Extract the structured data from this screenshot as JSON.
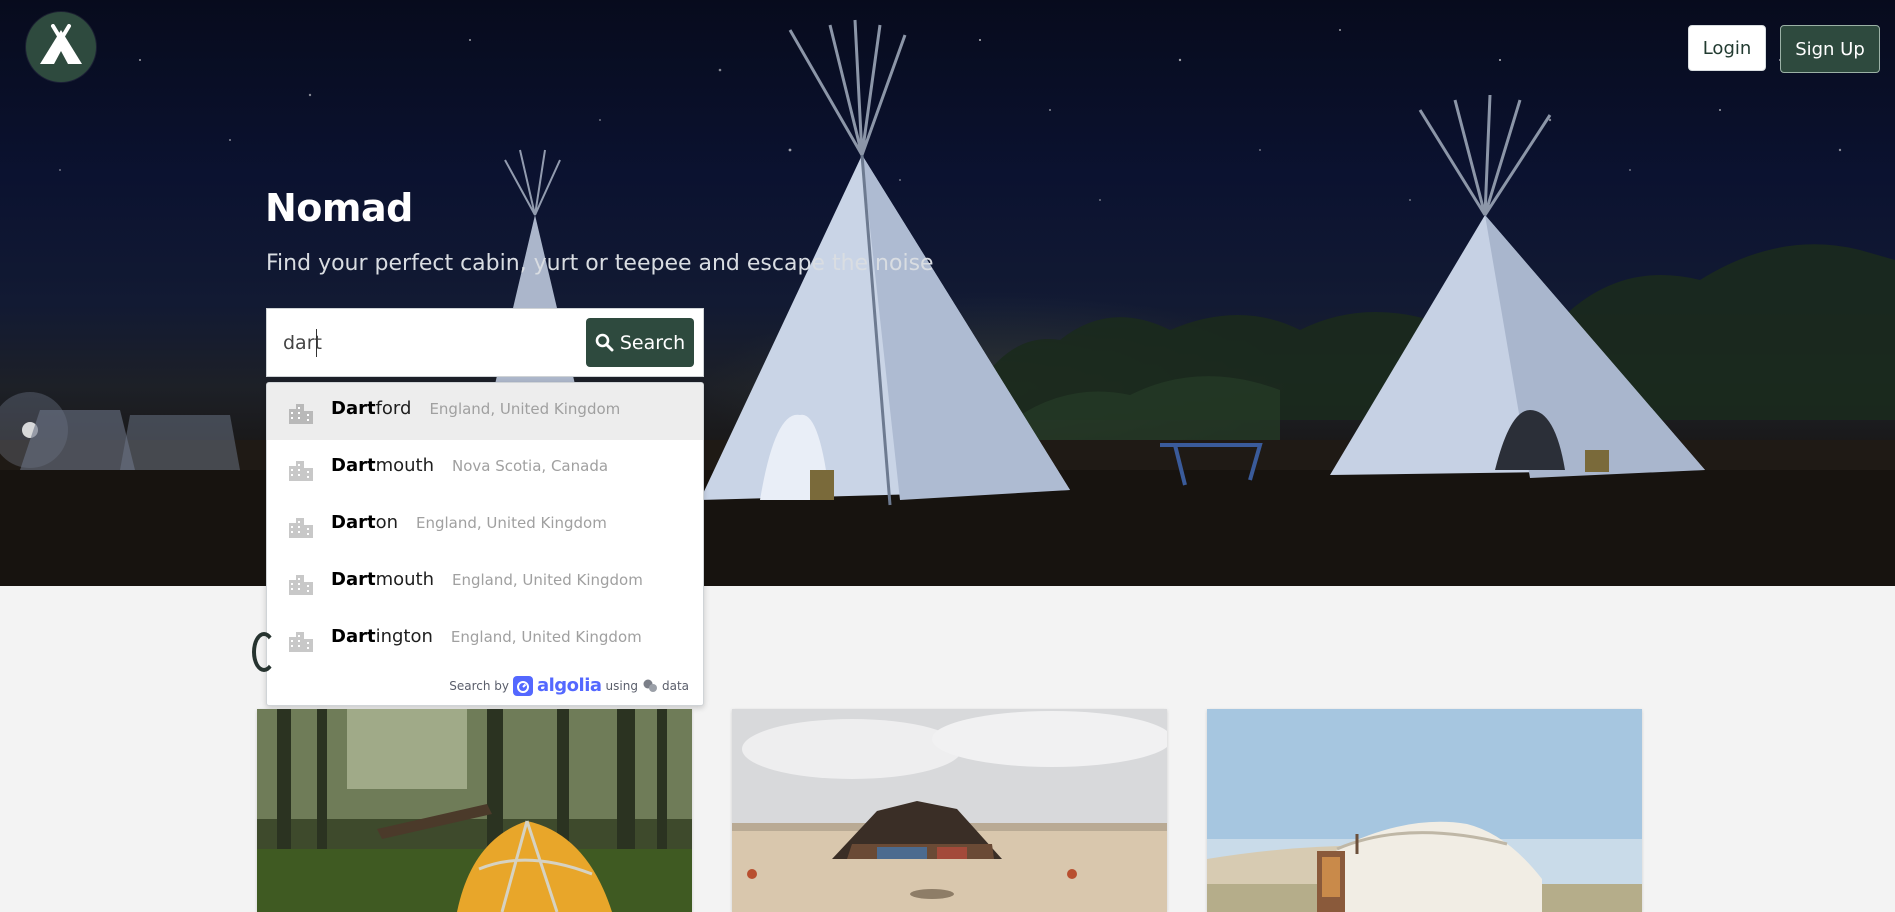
{
  "brand": {
    "logo_icon": "camping-tent-icon",
    "logo_colors": {
      "bg": "#2e4a3e",
      "fg": "#ffffff"
    }
  },
  "nav": {
    "login_label": "Login",
    "signup_label": "Sign Up"
  },
  "hero": {
    "title": "Nomad",
    "subtitle": "Find your perfect cabin, yurt or teepee and escape the noise"
  },
  "search": {
    "value": "dart",
    "button_label": "Search",
    "button_icon": "search-icon"
  },
  "suggestions": [
    {
      "match": "Dart",
      "rest": "ford",
      "region": "England, United Kingdom",
      "icon": "city-icon",
      "highlighted": true
    },
    {
      "match": "Dart",
      "rest": "mouth",
      "region": "Nova Scotia, Canada",
      "icon": "city-icon",
      "highlighted": false
    },
    {
      "match": "Dart",
      "rest": "on",
      "region": "England, United Kingdom",
      "icon": "city-icon",
      "highlighted": false
    },
    {
      "match": "Dart",
      "rest": "mouth",
      "region": "England, United Kingdom",
      "icon": "city-icon",
      "highlighted": false
    },
    {
      "match": "Dart",
      "rest": "ington",
      "region": "England, United Kingdom",
      "icon": "city-icon",
      "highlighted": false
    }
  ],
  "attribution": {
    "search_by": "Search by",
    "provider": "algolia",
    "using": "using",
    "data": "data"
  },
  "cards": [
    {
      "image": "forest-tent-photo"
    },
    {
      "image": "desert-tent-photo"
    },
    {
      "image": "yurt-photo"
    }
  ],
  "colors": {
    "accent": "#2e4a3e",
    "page_bg": "#f3f3f3",
    "algolia": "#5468ff"
  }
}
